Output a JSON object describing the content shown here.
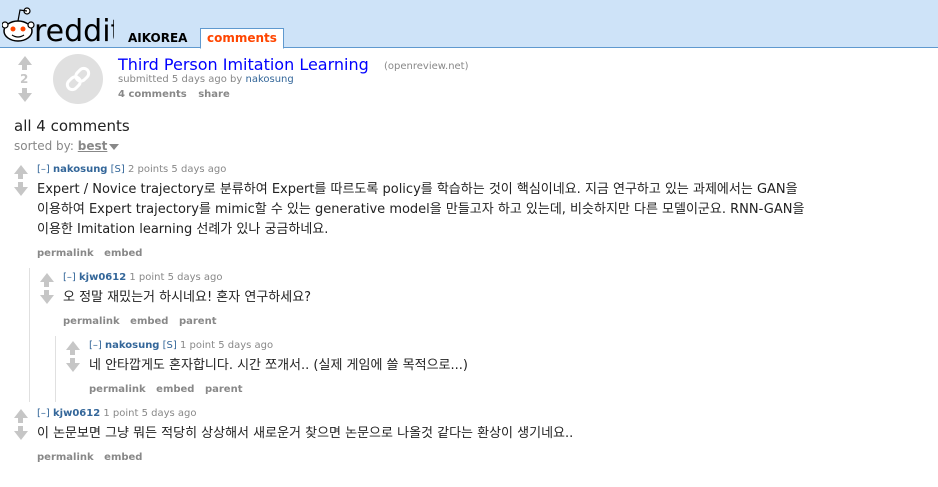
{
  "header": {
    "logo_text": "reddit",
    "subreddit": "AIKOREA",
    "tab": "comments"
  },
  "post": {
    "score": "2",
    "title": "Third Person Imitation Learning",
    "domain": "(openreview.net)",
    "submitted": "submitted 5 days ago by",
    "author": "nakosung",
    "comments_link": "4 comments",
    "share": "share"
  },
  "comment_area": {
    "heading": "all 4 comments",
    "sort_label": "sorted by:",
    "sort_value": "best"
  },
  "comments": [
    {
      "toggle": "[–]",
      "author": "nakosung",
      "submitter": "[S]",
      "meta": "2 points 5 days ago",
      "lines": [
        "Expert / Novice trajectory로 분류하여 Expert를 따르도록 policy를 학습하는 것이 핵심이네요. 지금 연구하고 있는 과제에서는 GAN을",
        "이용하여 Expert trajectory를 mimic할 수 있는 generative model을 만들고자 하고 있는데, 비슷하지만 다른 모델이군요. RNN-GAN을",
        "이용한 Imitation learning 선례가 있나 궁금하네요."
      ],
      "buttons": [
        "permalink",
        "embed"
      ]
    },
    {
      "toggle": "[–]",
      "author": "kjw0612",
      "meta": "1 point 5 days ago",
      "lines": [
        "오 정말 재밌는거 하시네요! 혼자 연구하세요?"
      ],
      "buttons": [
        "permalink",
        "embed",
        "parent"
      ]
    },
    {
      "toggle": "[–]",
      "author": "nakosung",
      "submitter": "[S]",
      "meta": "1 point 5 days ago",
      "lines": [
        "네 안타깝게도 혼자합니다. 시간 쪼개서.. (실제 게임에 쓸 목적으로...)"
      ],
      "buttons": [
        "permalink",
        "embed",
        "parent"
      ]
    },
    {
      "toggle": "[–]",
      "author": "kjw0612",
      "meta": "1 point 5 days ago",
      "lines": [
        "이 논문보면 그냥 뭐든 적당히 상상해서 새로운거 찾으면 논문으로 나올것 같다는 환상이 생기네요.."
      ],
      "buttons": [
        "permalink",
        "embed"
      ]
    }
  ]
}
